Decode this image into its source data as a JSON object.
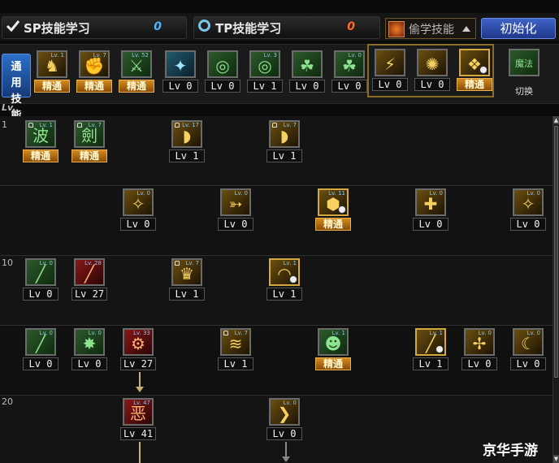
{
  "tabs": {
    "sp": {
      "label": "SP技能学习",
      "points": "0"
    },
    "tp": {
      "label": "TP技能学习",
      "points": "0"
    },
    "steal": {
      "label": "偷学技能"
    },
    "init_button": "初始化"
  },
  "generic_label": "通用技能",
  "swap": {
    "icon_text": "魔法",
    "label": "切换"
  },
  "level_header": "Lv.",
  "row_numbers": [
    "1",
    "10",
    "20"
  ],
  "strip_skills": [
    {
      "badge": "精通",
      "type": "jt",
      "tiny": "Lv. 1",
      "color": "y",
      "glyph": "♞"
    },
    {
      "badge": "精通",
      "type": "jt",
      "tiny": "Lv. 7",
      "color": "y",
      "glyph": "✊"
    },
    {
      "badge": "精通",
      "type": "jt",
      "tiny": "Lv. 52",
      "color": "g",
      "glyph": "⚔"
    },
    {
      "badge": "Lv 0",
      "type": "lv",
      "tiny": "",
      "color": "b",
      "glyph": "✦"
    },
    {
      "badge": "Lv 0",
      "type": "lv",
      "tiny": "",
      "color": "g",
      "glyph": "◎"
    },
    {
      "badge": "Lv 1",
      "type": "lv",
      "tiny": "Lv. 3",
      "color": "g",
      "glyph": "◎"
    },
    {
      "badge": "Lv 0",
      "type": "lv",
      "tiny": "",
      "color": "g",
      "glyph": "☘"
    },
    {
      "badge": "Lv 0",
      "type": "lv",
      "tiny": "Lv. 0",
      "color": "g",
      "glyph": "☘"
    }
  ],
  "steal_skills": [
    {
      "badge": "Lv 0",
      "type": "lv",
      "color": "y",
      "glyph": "⚡"
    },
    {
      "badge": "Lv 0",
      "type": "lv",
      "color": "y",
      "glyph": "✺"
    },
    {
      "badge": "精通",
      "type": "jt",
      "color": "y",
      "glyph": "❖",
      "clock": true
    }
  ],
  "tree": [
    {
      "badge": "精通",
      "type": "jt",
      "tiny": "Lv. 1",
      "color": "g",
      "glyph": "波",
      "lock": true
    },
    {
      "badge": "精通",
      "type": "jt",
      "tiny": "Lv. 7",
      "color": "g",
      "glyph": "劍",
      "lock": true
    },
    {
      "badge": "Lv 1",
      "type": "lv",
      "tiny": "Lv. 17",
      "color": "y",
      "glyph": "◗",
      "lock": true
    },
    {
      "badge": "Lv 1",
      "type": "lv",
      "tiny": "Lv. 7",
      "color": "y",
      "glyph": "◗",
      "lock": true
    },
    {
      "badge": "Lv 0",
      "type": "lv",
      "tiny": "Lv. 0",
      "color": "y",
      "glyph": "✧"
    },
    {
      "badge": "Lv 0",
      "type": "lv",
      "tiny": "Lv. 0",
      "color": "y",
      "glyph": "➳"
    },
    {
      "badge": "精通",
      "type": "jt",
      "tiny": "Lv. 11",
      "color": "y",
      "glyph": "⬢",
      "clock": true
    },
    {
      "badge": "Lv 0",
      "type": "lv",
      "tiny": "Lv. 0",
      "color": "y",
      "glyph": "✚"
    },
    {
      "badge": "Lv 0",
      "type": "lv",
      "tiny": "Lv. 0",
      "color": "y",
      "glyph": "✧"
    },
    {
      "badge": "Lv 0",
      "type": "lv",
      "tiny": "Lv. 0",
      "color": "g",
      "glyph": "╱"
    },
    {
      "badge": "Lv 27",
      "type": "lv",
      "tiny": "Lv. 28",
      "color": "r",
      "glyph": "╱"
    },
    {
      "badge": "Lv 1",
      "type": "lv",
      "tiny": "Lv. 7",
      "color": "y",
      "glyph": "♛",
      "lock": true
    },
    {
      "badge": "Lv 1",
      "type": "lv",
      "tiny": "Lv. 1",
      "color": "y",
      "glyph": "◠",
      "clock": true
    },
    {
      "badge": "Lv 0",
      "type": "lv",
      "tiny": "Lv. 0",
      "color": "g",
      "glyph": "╱"
    },
    {
      "badge": "Lv 0",
      "type": "lv",
      "tiny": "Lv. 0",
      "color": "g",
      "glyph": "✸"
    },
    {
      "badge": "Lv 27",
      "type": "lv",
      "tiny": "Lv. 33",
      "color": "r",
      "glyph": "⚙"
    },
    {
      "badge": "Lv 1",
      "type": "lv",
      "tiny": "Lv. 7",
      "color": "y",
      "glyph": "≋",
      "lock": true
    },
    {
      "badge": "精通",
      "type": "jt",
      "tiny": "Lv. 1",
      "color": "g",
      "glyph": "☻"
    },
    {
      "badge": "Lv 1",
      "type": "lv",
      "tiny": "Lv. 1",
      "color": "y",
      "glyph": "╱",
      "clock": true
    },
    {
      "badge": "Lv 0",
      "type": "lv",
      "tiny": "Lv. 0",
      "color": "y",
      "glyph": "✢"
    },
    {
      "badge": "Lv 0",
      "type": "lv",
      "tiny": "Lv. 0",
      "color": "y",
      "glyph": "☾"
    },
    {
      "badge": "Lv 41",
      "type": "lv",
      "tiny": "Lv. 47",
      "color": "r",
      "glyph": "恶"
    },
    {
      "badge": "Lv 0",
      "type": "lv",
      "tiny": "Lv. 0",
      "color": "y",
      "glyph": "❯"
    }
  ],
  "watermark": "京华手游"
}
